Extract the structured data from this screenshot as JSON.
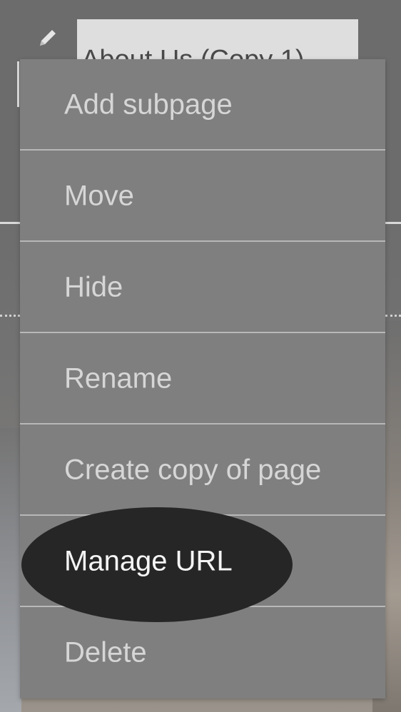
{
  "header": {
    "page_title_partial": "About Us (Copy 1)",
    "edit_icon": "pencil-icon"
  },
  "menu": {
    "items": [
      {
        "label": "Add subpage"
      },
      {
        "label": "Move"
      },
      {
        "label": "Hide"
      },
      {
        "label": "Rename"
      },
      {
        "label": "Create copy of page"
      },
      {
        "label": "Manage URL",
        "highlighted": true
      },
      {
        "label": "Delete"
      }
    ]
  },
  "colors": {
    "menu_background": "#7f7f7f",
    "menu_text": "#d6d6d6",
    "separator": "#b8b8b8",
    "highlight": "#262626",
    "highlight_text": "#f5f5f5"
  }
}
